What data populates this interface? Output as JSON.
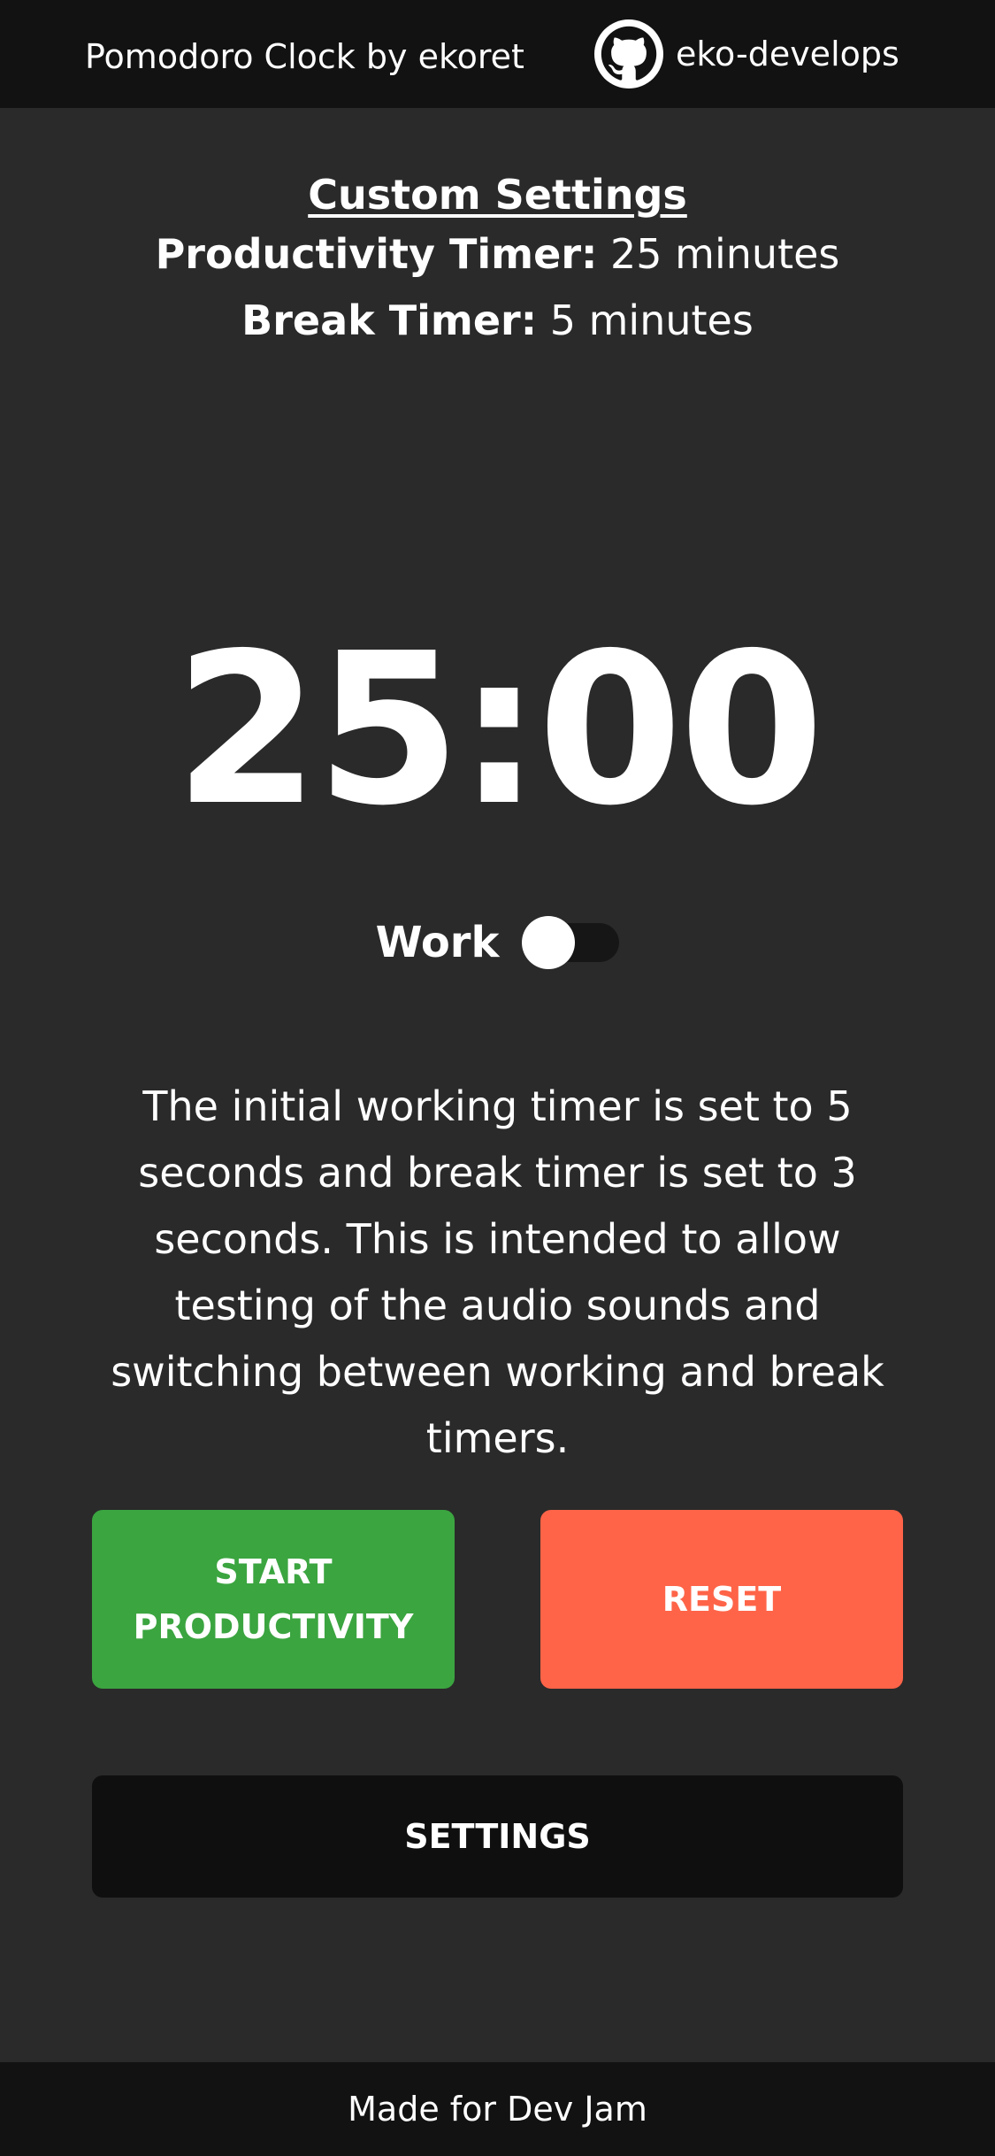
{
  "header": {
    "title": "Pomodoro Clock by ekoret",
    "github_label": "eko-develops",
    "github_icon": "github-icon"
  },
  "settings": {
    "heading": "Custom Settings",
    "productivity_label": "Productivity Timer:",
    "productivity_value": "25 minutes",
    "break_label": "Break Timer:",
    "break_value": "5 minutes"
  },
  "timer": {
    "display": "25:00"
  },
  "mode": {
    "label": "Work",
    "toggle_on": false
  },
  "info": {
    "text": "The initial working timer is set to 5 seconds and break timer is set to 3 seconds. This is intended to allow testing of the audio sounds and switching between working and break timers."
  },
  "buttons": {
    "start_label": "START PRODUCTIVITY",
    "reset_label": "RESET",
    "settings_label": "SETTINGS"
  },
  "footer": {
    "text": "Made for Dev Jam"
  },
  "colors": {
    "background": "#2a2a2a",
    "header_bg": "#121212",
    "start_button": "#3ba540",
    "reset_button": "#ff6448",
    "settings_button": "#0f0f0f"
  }
}
